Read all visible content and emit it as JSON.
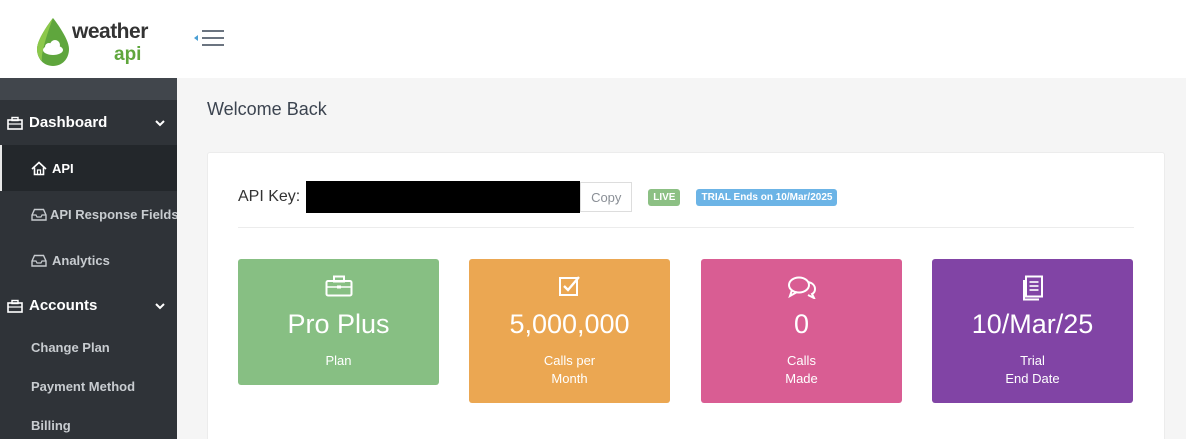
{
  "brand": {
    "line1": "weather",
    "line2": "api"
  },
  "header": {
    "menu_toggle": "menu-toggle-icon"
  },
  "sidebar": {
    "groups": [
      {
        "label": "Dashboard",
        "icon": "briefcase-icon"
      },
      {
        "label": "Accounts",
        "icon": "briefcase-icon"
      }
    ],
    "dashboard_items": [
      {
        "label": "API",
        "icon": "home-icon",
        "active": true
      },
      {
        "label": "API Response Fields",
        "icon": "inbox-icon"
      },
      {
        "label": "Analytics",
        "icon": "inbox-icon"
      }
    ],
    "account_items": [
      {
        "label": "Change Plan"
      },
      {
        "label": "Payment Method"
      },
      {
        "label": "Billing"
      }
    ]
  },
  "main": {
    "welcome": "Welcome Back",
    "api_key": {
      "label": "API Key:",
      "copy_label": "Copy",
      "live_badge": "LIVE",
      "trial_badge": "TRIAL Ends on 10/Mar/2025"
    },
    "tiles": [
      {
        "value": "Pro Plus",
        "line1": "Plan",
        "line2": "",
        "icon": "briefcase-icon",
        "color": "#87bf83"
      },
      {
        "value": "5,000,000",
        "line1": "Calls per",
        "line2": "Month",
        "icon": "checkbox-icon",
        "color": "#eba752"
      },
      {
        "value": "0",
        "line1": "Calls",
        "line2": "Made",
        "icon": "chat-icon",
        "color": "#d95d93"
      },
      {
        "value": "10/Mar/25",
        "line1": "Trial",
        "line2": "End Date",
        "icon": "document-icon",
        "color": "#8144a5"
      }
    ]
  },
  "colors": {
    "sidebar_bg": "#2f3338",
    "brand_green": "#5fa63d",
    "live": "#8cc084",
    "trial": "#6cb4e6"
  }
}
